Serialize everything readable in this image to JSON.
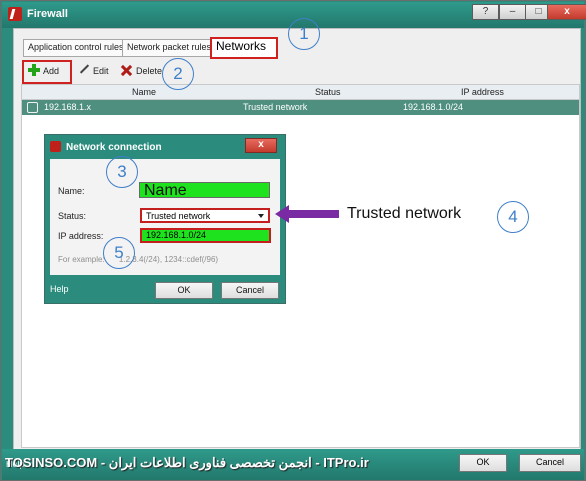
{
  "window": {
    "title": "Firewall"
  },
  "tabs": [
    {
      "label": "Application control rules"
    },
    {
      "label": "Network packet rules"
    },
    {
      "label": "Networks"
    }
  ],
  "toolbar": {
    "add": "Add",
    "edit": "Edit",
    "delete": "Delete"
  },
  "grid": {
    "columns": [
      "Name",
      "Status",
      "IP address"
    ],
    "rows": [
      {
        "name": "192.168.1.x",
        "status": "Trusted network",
        "ip": "192.168.1.0/24"
      }
    ]
  },
  "dialog": {
    "title": "Network connection",
    "name_label": "Name:",
    "name_value": "Name",
    "status_label": "Status:",
    "status_value": "Trusted network",
    "ip_label": "IP address:",
    "ip_value": "192.168.1.0/24",
    "example_label": "For example:",
    "example_text": "1.2.3.4(/24), 1234::cdef(/96)",
    "help": "Help",
    "ok": "OK",
    "cancel": "Cancel"
  },
  "annotations": {
    "markers": [
      "1",
      "2",
      "3",
      "4",
      "5"
    ],
    "callout": "Trusted network"
  },
  "footer": {
    "help": "Help",
    "ok": "OK",
    "cancel": "Cancel",
    "watermark": "TOSINSO.COM - انجمن تخصصی فناوری اطلاعات ایران - ITPro.ir"
  },
  "colors": {
    "titlebar": "#2b8c7e",
    "highlight": "#d02121",
    "field_green": "#1fe21f",
    "callout_arrow": "#7a2aa3",
    "marker": "#3f7fc9"
  }
}
